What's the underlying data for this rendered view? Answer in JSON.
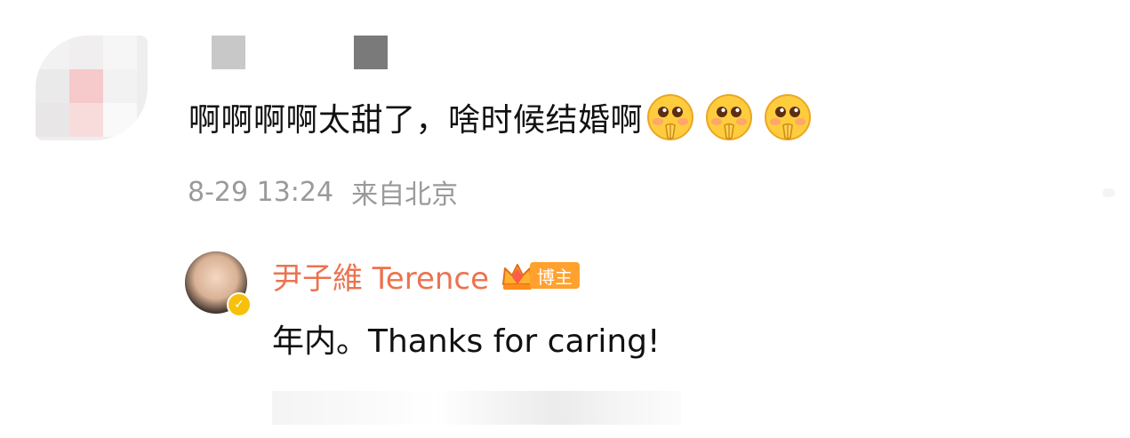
{
  "comment": {
    "text": "啊啊啊啊太甜了，啥时候结婚啊",
    "emojis": [
      "pleading-emoji",
      "pleading-emoji",
      "pleading-emoji"
    ],
    "date": "8-29 13:24",
    "location": "来自北京"
  },
  "reply": {
    "author": "尹子維 Terence",
    "badge_label": "博主",
    "text": "年内。Thanks for caring!"
  },
  "colors": {
    "author": "#eb7350",
    "meta": "#9a9a9a",
    "badge": "#ffa12d",
    "verified": "#f7c10b"
  }
}
